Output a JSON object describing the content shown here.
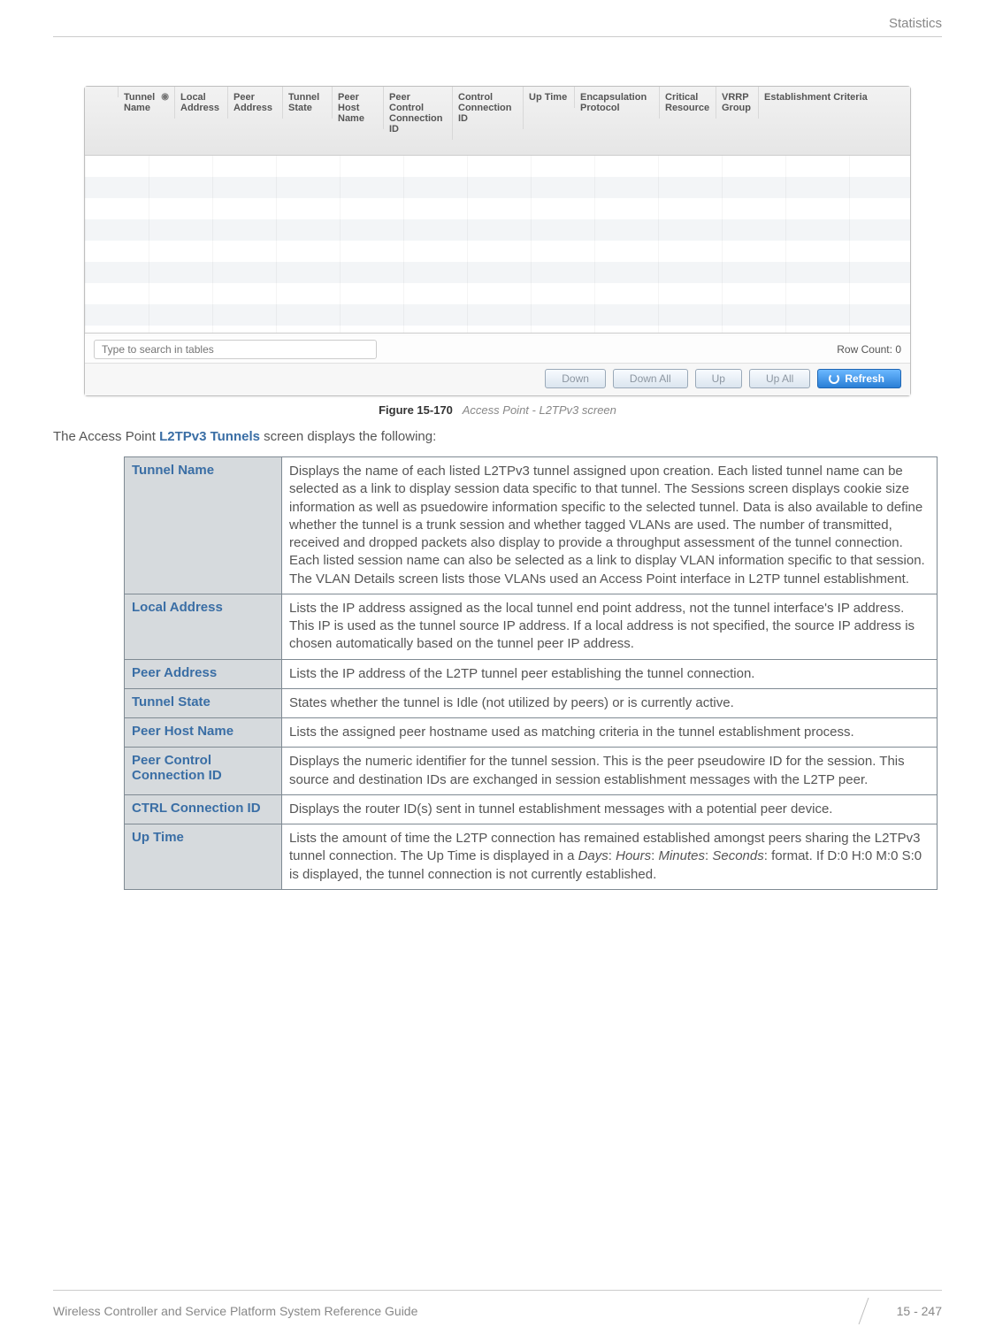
{
  "header": {
    "section": "Statistics"
  },
  "grid": {
    "columns": [
      "Tunnel Name",
      "Local Address",
      "Peer Address",
      "Tunnel State",
      "Peer Host Name",
      "Peer Control Connection ID",
      "Control Connection ID",
      "Up Time",
      "Encapsulation Protocol",
      "Critical Resource",
      "VRRP Group",
      "Establishment Criteria"
    ],
    "search_placeholder": "Type to search in tables",
    "row_count_label": "Row Count:",
    "row_count_value": "0",
    "buttons": {
      "down": "Down",
      "down_all": "Down All",
      "up": "Up",
      "up_all": "Up All",
      "refresh": "Refresh"
    }
  },
  "figure": {
    "label": "Figure 15-170",
    "title": "Access Point - L2TPv3 screen"
  },
  "intro_prefix": "The Access Point ",
  "intro_kw": "L2TPv3 Tunnels",
  "intro_suffix": " screen displays the following:",
  "rows": {
    "tunnel_name": {
      "k": "Tunnel Name",
      "v": "Displays the name of each listed L2TPv3 tunnel assigned upon creation. Each listed tunnel name can be selected as a link to display session data specific to that tunnel. The Sessions screen displays cookie size information as well as psuedowire information specific to the selected tunnel. Data is also available to define whether the tunnel is a trunk session and whether tagged VLANs are used. The number of transmitted, received and dropped packets also display to provide a throughput assessment of the tunnel connection. Each listed session name can also be selected as a link to display VLAN information specific to that session. The VLAN Details screen lists those VLANs used an Access Point interface in L2TP tunnel establishment."
    },
    "local_address": {
      "k": "Local Address",
      "v": "Lists the IP address assigned as the local tunnel end point address, not the tunnel interface's IP address. This IP is used as the tunnel source IP address. If a local address is not specified, the source IP address is chosen automatically based on the tunnel peer IP address."
    },
    "peer_address": {
      "k": "Peer Address",
      "v": "Lists the IP address of the L2TP tunnel peer establishing the tunnel connection."
    },
    "tunnel_state": {
      "k": "Tunnel State",
      "v": "States whether the tunnel is Idle (not utilized by peers) or is currently active."
    },
    "peer_host_name": {
      "k": "Peer Host Name",
      "v": "Lists the assigned peer hostname used as matching criteria in the tunnel establishment process."
    },
    "peer_ctrl_conn": {
      "k": "Peer Control Connection ID",
      "v": "Displays the numeric identifier for the tunnel session. This is the peer pseudowire ID for the session. This source and destination IDs are exchanged in session establishment messages with the L2TP peer."
    },
    "ctrl_conn": {
      "k": "CTRL Connection ID",
      "v": "Displays the router ID(s) sent in tunnel establishment messages with a potential peer device."
    },
    "up_time": {
      "k": "Up Time",
      "v_pre": "Lists the amount of time the L2TP connection has remained established amongst peers sharing the L2TPv3 tunnel connection. The Up Time is displayed in a ",
      "it1": "Days",
      "sep": ": ",
      "it2": "Hours",
      "it3": "Minutes",
      "it4": "Seconds",
      "v_post": ": format. If D:0 H:0 M:0 S:0 is displayed, the tunnel connection is not currently established."
    }
  },
  "footer": {
    "guide": "Wireless Controller and Service Platform System Reference Guide",
    "page": "15 - 247"
  }
}
